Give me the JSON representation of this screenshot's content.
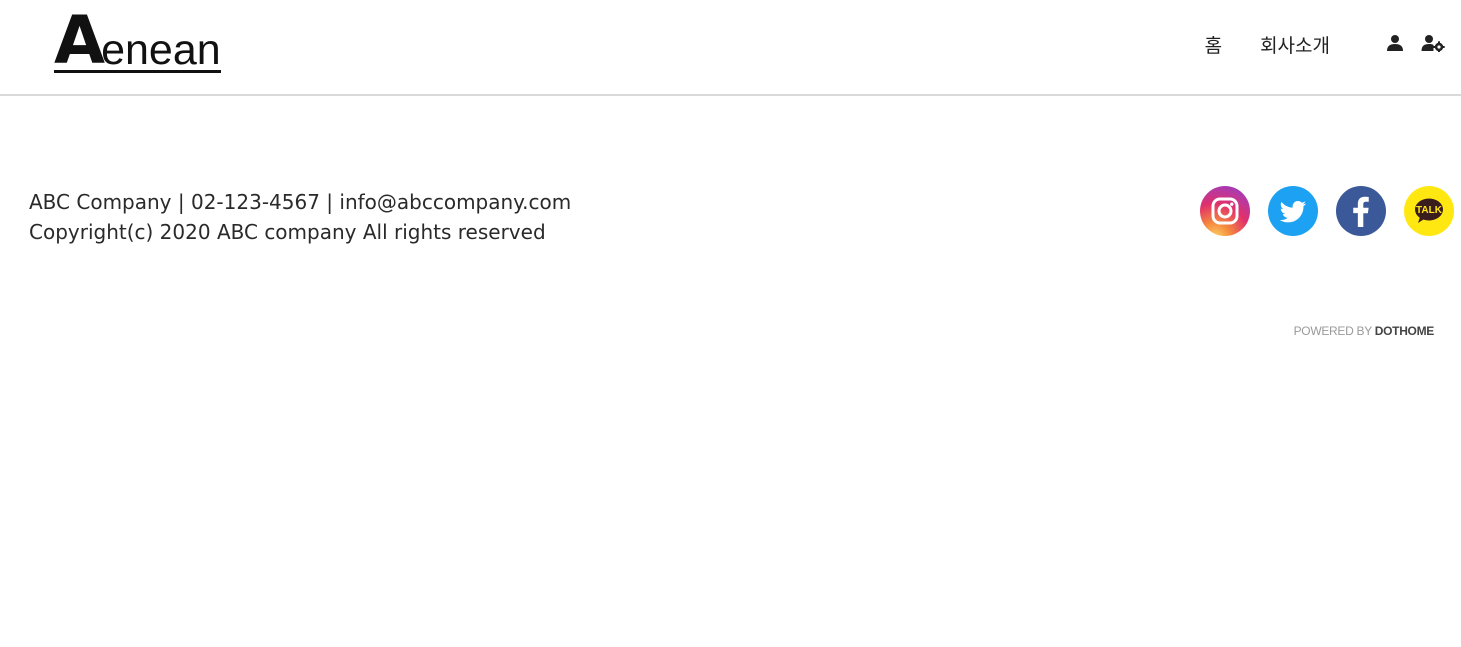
{
  "header": {
    "logo_big": "A",
    "logo_rest": "enean",
    "nav": [
      {
        "label": "홈"
      },
      {
        "label": "회사소개"
      }
    ]
  },
  "footer": {
    "line1": "ABC Company | 02-123-4567 | info@abccompany.com",
    "line2": "Copyright(c) 2020 ABC company All rights reserved",
    "kakao_label": "TALK",
    "powered_pre": "POWERED BY ",
    "powered_brand": "DOTHOME"
  },
  "icons": {
    "user": "user-icon",
    "user_settings": "user-settings-icon",
    "instagram": "instagram-icon",
    "twitter": "twitter-icon",
    "facebook": "facebook-icon",
    "kakaotalk": "kakaotalk-icon"
  },
  "colors": {
    "twitter": "#1da1f2",
    "facebook": "#3b5998",
    "kakao": "#ffe812"
  }
}
